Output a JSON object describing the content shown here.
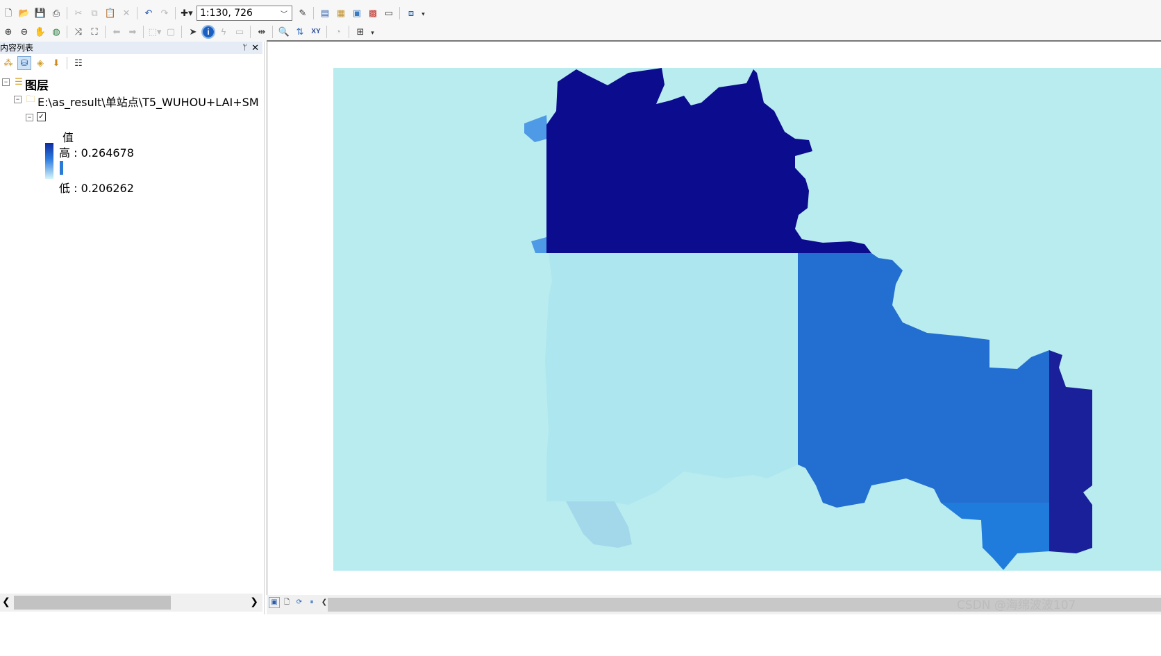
{
  "toolbar": {
    "scale_value": "1:130, 726",
    "row1_icons": [
      "new-document-icon",
      "open-folder-icon",
      "save-icon",
      "print-icon",
      "cut-icon",
      "copy-icon",
      "paste-icon",
      "delete-icon",
      "undo-icon",
      "redo-icon",
      "add-data-icon",
      "editor-toolbar-icon",
      "table-of-contents-icon",
      "catalog-icon",
      "search-window-icon",
      "arctoolbox-icon",
      "python-window-icon",
      "model-builder-icon"
    ],
    "row2_icons": [
      "zoom-in-icon",
      "zoom-out-icon",
      "pan-icon",
      "full-extent-icon",
      "fixed-zoom-in-icon",
      "fixed-zoom-out-icon",
      "back-extent-icon",
      "forward-extent-icon",
      "select-features-icon",
      "clear-selection-icon",
      "select-elements-icon",
      "identify-icon",
      "hyperlink-icon",
      "html-popup-icon",
      "measure-icon",
      "find-icon",
      "find-route-icon",
      "go-to-xy-icon",
      "time-slider-icon",
      "create-viewer-window-icon"
    ]
  },
  "toc": {
    "title": "内容列表",
    "pin": "ᛘ",
    "close": "✕",
    "layers_label": "图层",
    "folder_path": "E:\\as_result\\单站点\\T5_WUHOU+LAI+SM",
    "legend_title": "值",
    "legend_high": "高 : 0.264678",
    "legend_low": "低 : 0.206262"
  },
  "map": {
    "colors": {
      "background": "#b9ecef",
      "dark_navy": "#0c0c8e",
      "medium_blue": "#226fd1",
      "light_cyan": "#aee6ef",
      "light_blue": "#4f9ae6",
      "pale_blue": "#a3d8eb",
      "navy_right": "#1a1f9a",
      "bright_blue": "#1f7cdc"
    }
  },
  "watermark": "CSDN @海绵波波107"
}
